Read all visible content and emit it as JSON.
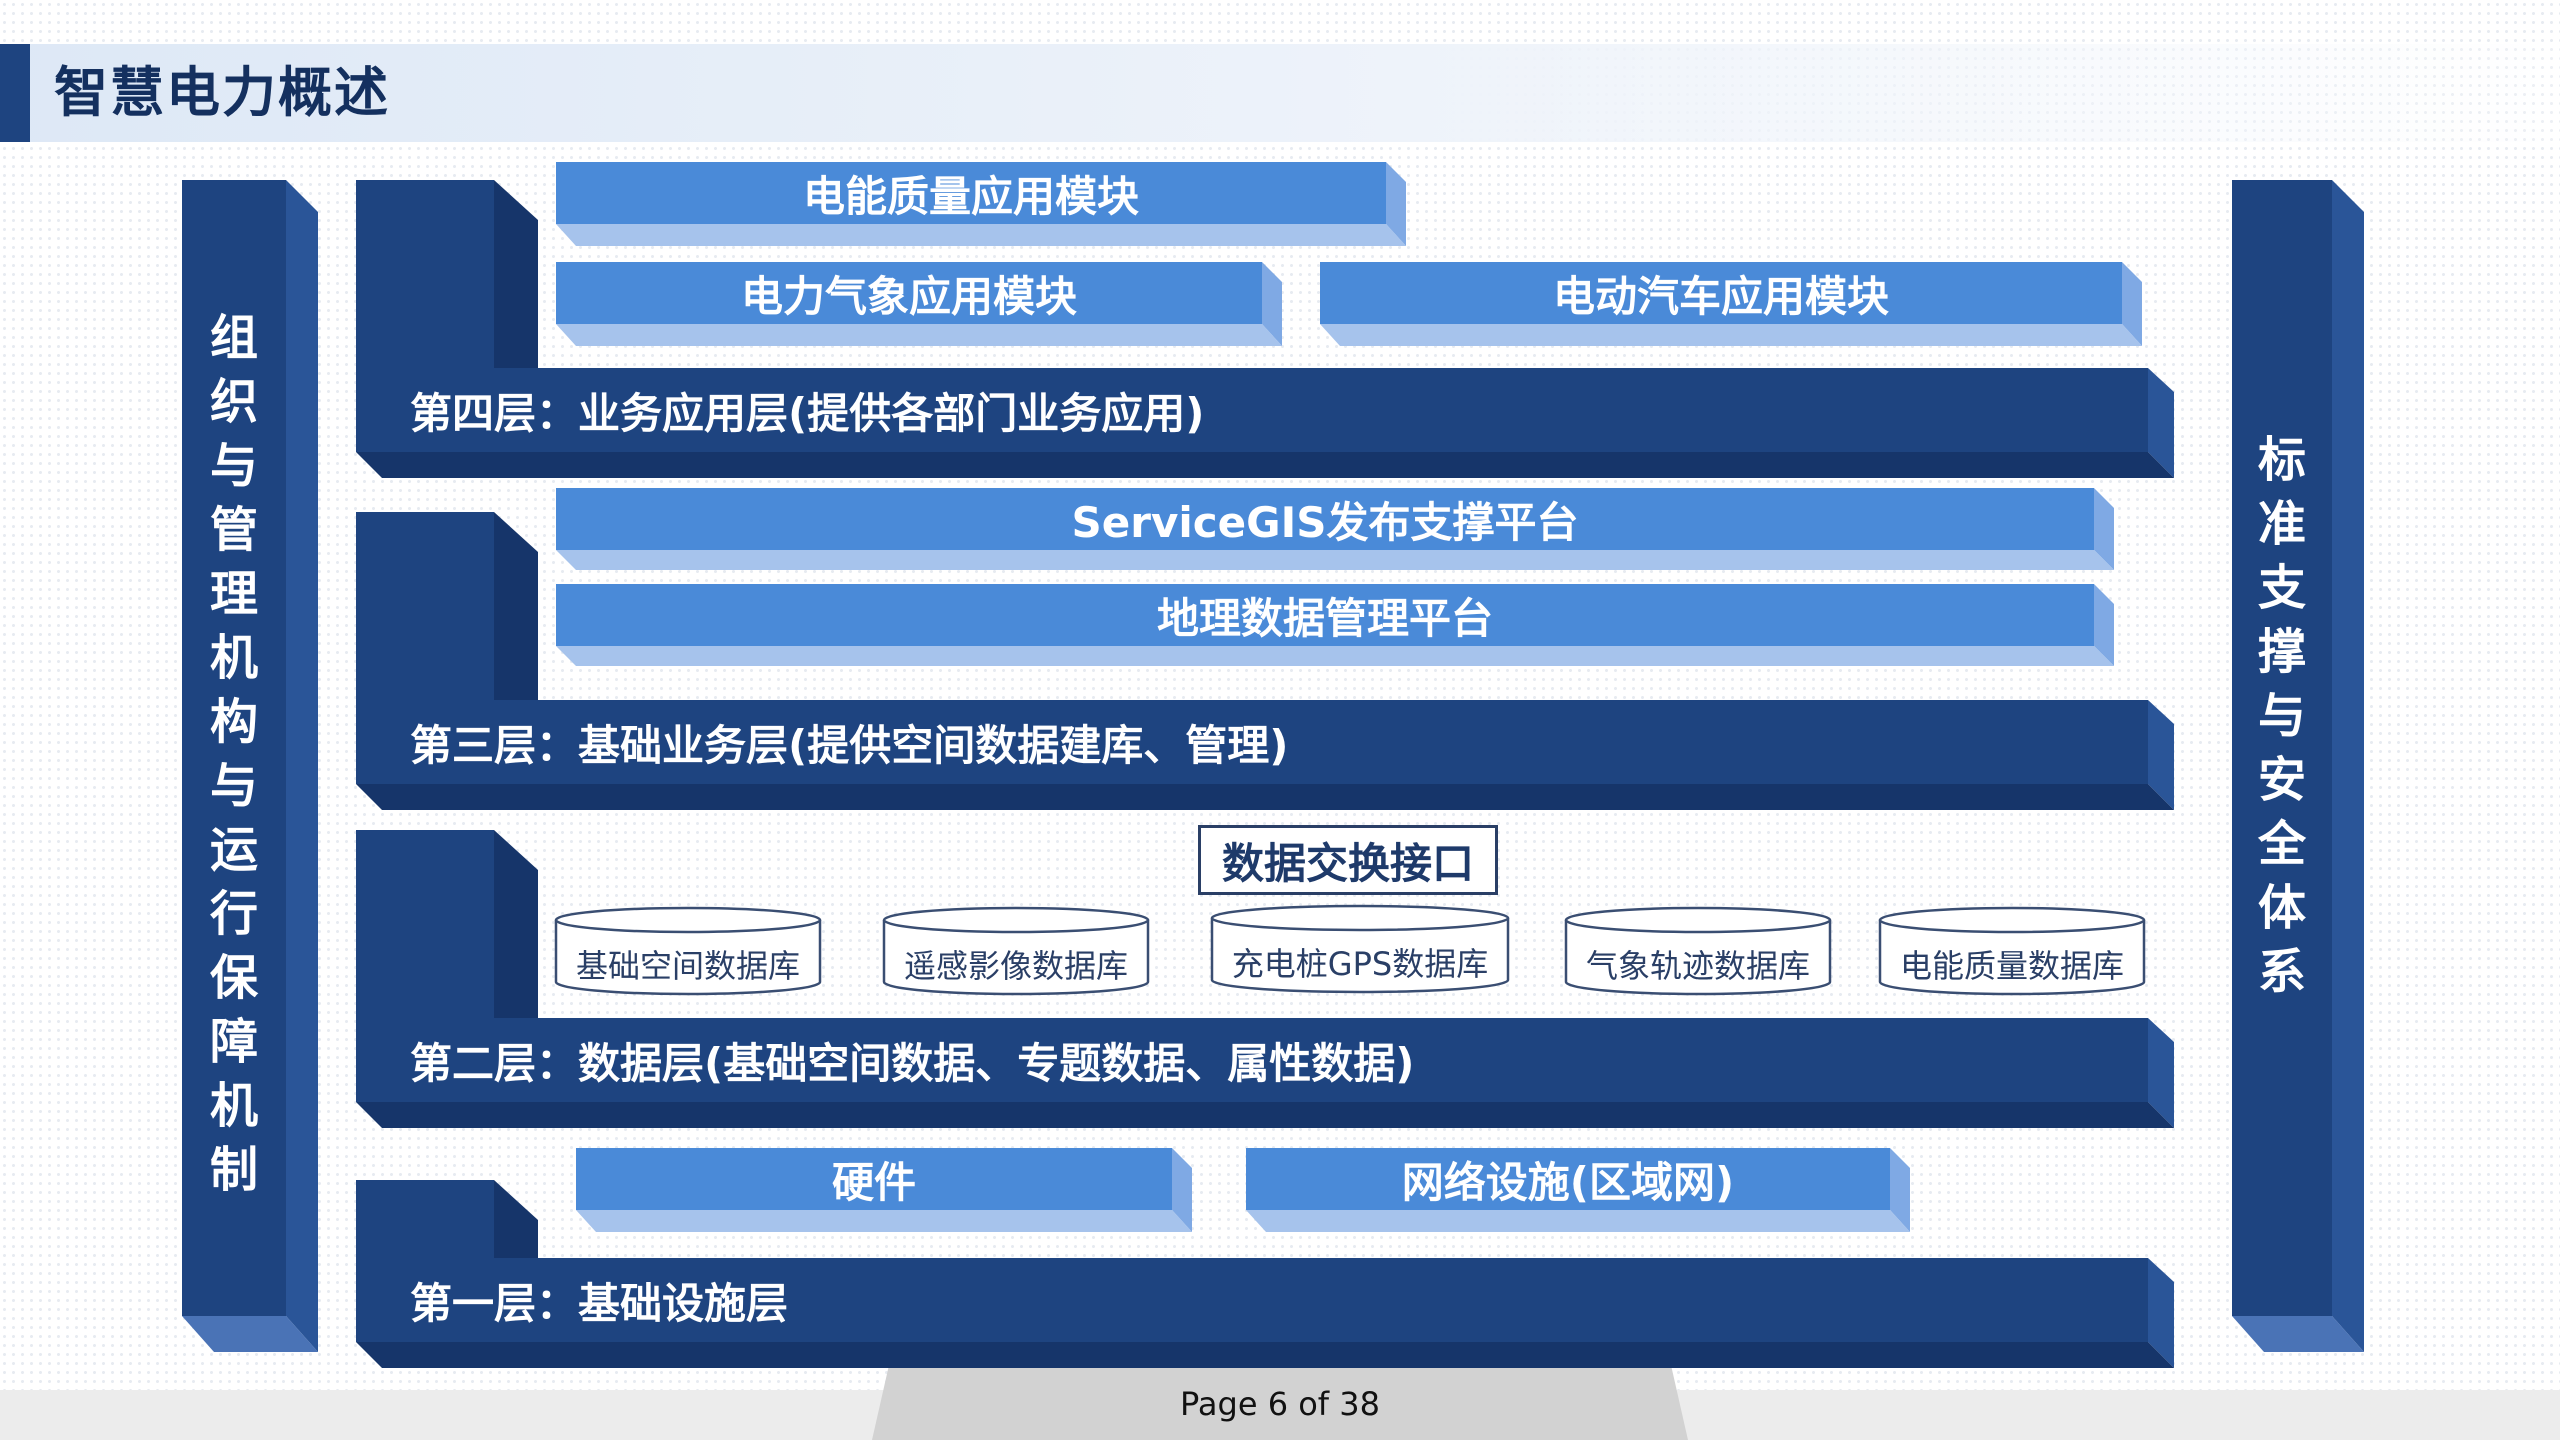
{
  "page_title": "智慧电力概述",
  "left_pillar": {
    "chars": [
      "组",
      "织",
      "与",
      "管",
      "理",
      "机",
      "构",
      "与",
      "运",
      "行",
      "保",
      "障",
      "机",
      "制"
    ]
  },
  "right_pillar": {
    "chars": [
      "标",
      "准",
      "支",
      "撑",
      "与",
      "安",
      "全",
      "体",
      "系"
    ]
  },
  "layer4": {
    "label": "第四层：业务应用层(提供各部门业务应用)",
    "modules": [
      "电能质量应用模块",
      "电力气象应用模块",
      "电动汽车应用模块"
    ]
  },
  "layer3": {
    "label": "第三层：基础业务层(提供空间数据建库、管理)",
    "modules": [
      "ServiceGIS发布支撑平台",
      "地理数据管理平台"
    ]
  },
  "layer2": {
    "label": "第二层：数据层(基础空间数据、专题数据、属性数据)",
    "interface": "数据交换接口",
    "databases": [
      "基础空间数据库",
      "遥感影像数据库",
      "充电桩GPS数据库",
      "气象轨迹数据库",
      "电能质量数据库"
    ]
  },
  "layer1": {
    "label": "第一层：基础设施层",
    "modules": [
      "硬件",
      "网络设施(区域网)"
    ]
  },
  "footer": {
    "page": "Page 6 of 38"
  },
  "colors": {
    "navy": "#1e4480",
    "blue": "#4a8ad8",
    "title_bg": "#e6eef8"
  }
}
